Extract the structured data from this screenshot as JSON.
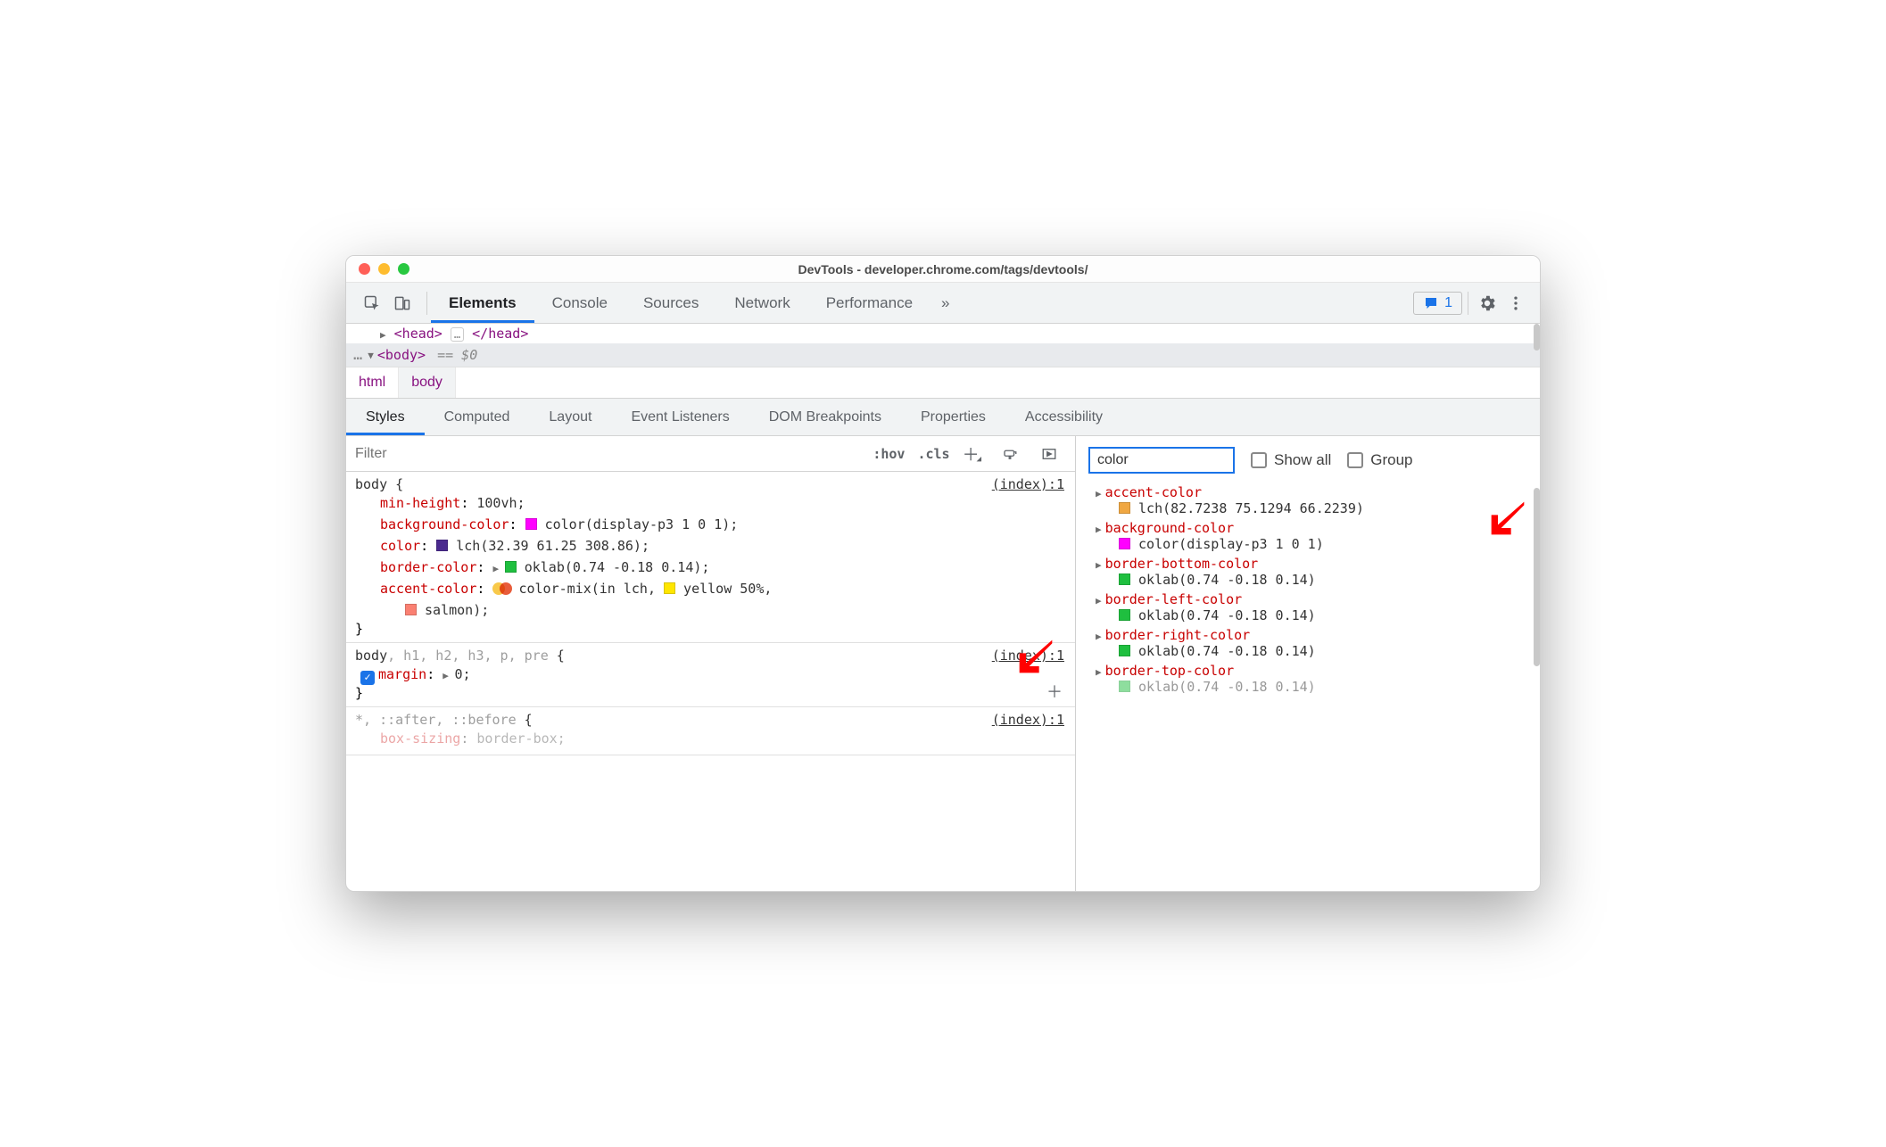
{
  "window": {
    "title": "DevTools - developer.chrome.com/tags/devtools/"
  },
  "toolbar": {
    "tabs": [
      "Elements",
      "Console",
      "Sources",
      "Network",
      "Performance"
    ],
    "active_tab": "Elements",
    "overflow_glyph": "»",
    "issues_count": "1"
  },
  "dom": {
    "head_open": "<head>",
    "head_close": "</head>",
    "ellipsis": "…",
    "body_open": "<body>",
    "eq_dollar": "== $0",
    "dots": "…"
  },
  "breadcrumb": [
    "html",
    "body"
  ],
  "styles": {
    "subtabs": [
      "Styles",
      "Computed",
      "Layout",
      "Event Listeners",
      "DOM Breakpoints",
      "Properties",
      "Accessibility"
    ],
    "active_subtab": "Styles",
    "filter_placeholder": "Filter",
    "ctrls": {
      "hov": ":hov",
      "cls": ".cls"
    },
    "rules": [
      {
        "selector_plain": "body {",
        "src": "(index):1",
        "decls": [
          {
            "prop": "min-height",
            "val": "100vh",
            "swatch": null
          },
          {
            "prop": "background-color",
            "val": "color(display-p3 1 0 1)",
            "swatch": "#ff00ff"
          },
          {
            "prop": "color",
            "val": "lch(32.39 61.25 308.86)",
            "swatch": "#4b2a8f"
          },
          {
            "prop": "border-color",
            "val": "oklab(0.74 -0.18 0.14)",
            "swatch": "#1fbf3f",
            "expand": true
          },
          {
            "prop": "accent-color",
            "val_pre": "color-mix(in lch, ",
            "mix_color": "yellow",
            "mix_pct": "50%",
            "cont": "salmon);",
            "swatch_mix": true,
            "swatch_inline": "#ffe600"
          }
        ],
        "close": "}"
      },
      {
        "selector_html": {
          "main": "body",
          "dim": ", h1, h2, h3, p, pre",
          "open": " {"
        },
        "src": "(index):1",
        "decls": [
          {
            "prop": "margin",
            "val": "0",
            "checked": true,
            "expand": true
          }
        ],
        "close": "}",
        "plus": true
      },
      {
        "selector_html": {
          "dim": "*, ::after, ::before",
          "open": " {"
        },
        "src": "(index):1",
        "decls": [
          {
            "prop": "box-sizing",
            "val": "border-box",
            "faded": true
          }
        ]
      }
    ]
  },
  "computed": {
    "filter_value": "color",
    "opts": {
      "show_all": "Show all",
      "group": "Group"
    },
    "items": [
      {
        "name": "accent-color",
        "val": "lch(82.7238 75.1294 66.2239)",
        "swatch": "#f0a742"
      },
      {
        "name": "background-color",
        "val": "color(display-p3 1 0 1)",
        "swatch": "#ff00ff"
      },
      {
        "name": "border-bottom-color",
        "val": "oklab(0.74 -0.18 0.14)",
        "swatch": "#1fbf3f"
      },
      {
        "name": "border-left-color",
        "val": "oklab(0.74 -0.18 0.14)",
        "swatch": "#1fbf3f"
      },
      {
        "name": "border-right-color",
        "val": "oklab(0.74 -0.18 0.14)",
        "swatch": "#1fbf3f"
      },
      {
        "name": "border-top-color",
        "val": "oklab(0.74 -0.18 0.14)",
        "swatch": "#1fbf3f",
        "cut": true
      }
    ]
  }
}
